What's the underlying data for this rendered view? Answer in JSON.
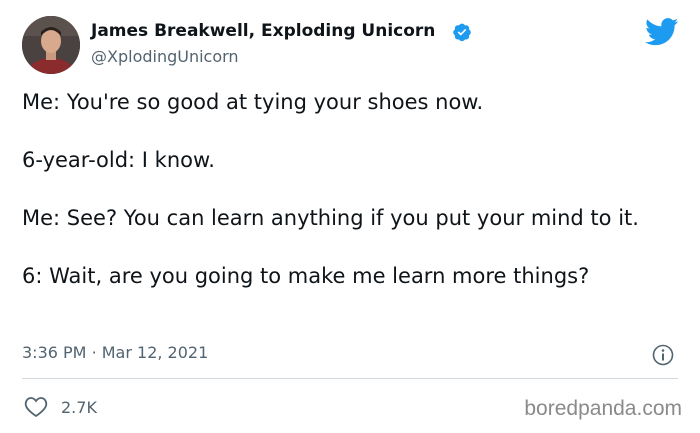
{
  "author": {
    "display_name": "James Breakwell, Exploding Unicorn",
    "handle": "@XplodingUnicorn",
    "verified": true
  },
  "tweet": {
    "paragraphs": [
      "Me: You're so good at tying your shoes now.",
      "6-year-old: I know.",
      "Me: See? You can learn anything if you put your mind to it.",
      "6: Wait, are you going to make me learn more things?"
    ],
    "time": "3:36 PM",
    "separator": "·",
    "date": "Mar 12, 2021"
  },
  "engagement": {
    "likes": "2.7K"
  },
  "watermark": "boredpanda.com",
  "icons": {
    "brand": "twitter-bird-icon",
    "verified": "verified-badge-icon",
    "info": "info-icon",
    "like": "heart-icon"
  },
  "colors": {
    "twitter_blue": "#1d9bf0",
    "text": "#0f1419",
    "muted": "#536471",
    "divider": "#cfd9de",
    "watermark": "#8a8a8a"
  }
}
